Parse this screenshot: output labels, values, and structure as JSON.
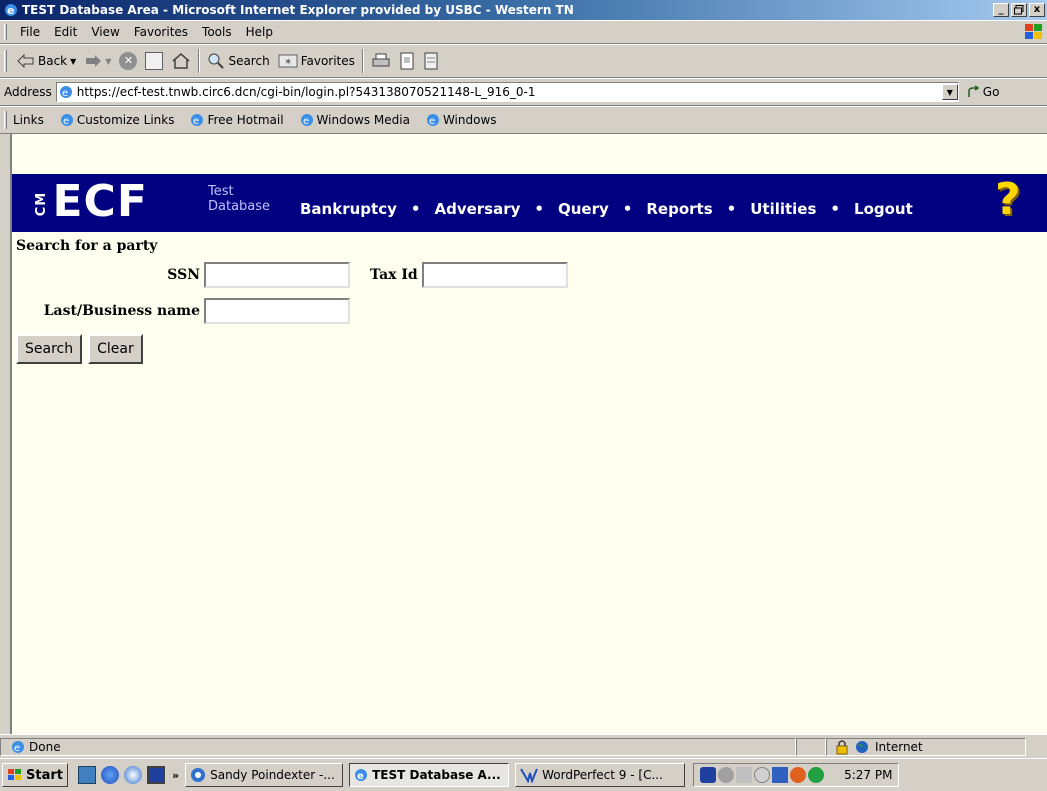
{
  "window": {
    "title": "TEST Database Area - Microsoft Internet Explorer provided by USBC - Western TN",
    "minimize": "_",
    "maximize": "×",
    "close": "x"
  },
  "menu": [
    "File",
    "Edit",
    "View",
    "Favorites",
    "Tools",
    "Help"
  ],
  "toolbar": {
    "back": "Back",
    "search": "Search",
    "favorites": "Favorites"
  },
  "address": {
    "label": "Address",
    "url": "https://ecf-test.tnwb.circ6.dcn/cgi-bin/login.pl?543138070521148-L_916_0-1",
    "go": "Go"
  },
  "links": {
    "label": "Links",
    "items": [
      "Customize Links",
      "Free Hotmail",
      "Windows Media",
      "Windows"
    ]
  },
  "ecf": {
    "logo": "ECF",
    "logo_prefix": "CM",
    "test_label_1": "Test",
    "test_label_2": "Database",
    "nav": [
      "Bankruptcy",
      "Adversary",
      "Query",
      "Reports",
      "Utilities",
      "Logout"
    ],
    "separator": "•",
    "help": "?"
  },
  "form": {
    "heading": "Search for a party",
    "ssn_label": "SSN",
    "ssn_value": "",
    "taxid_label": "Tax Id",
    "taxid_value": "",
    "lastname_label": "Last/Business name",
    "lastname_value": "",
    "search_button": "Search",
    "clear_button": "Clear"
  },
  "status": {
    "text": "Done",
    "zone": "Internet"
  },
  "taskbar": {
    "start": "Start",
    "chevron": "»",
    "tasks": [
      "Sandy Poindexter -...",
      "TEST Database A...",
      "WordPerfect 9 - [C..."
    ],
    "clock": "5:27 PM"
  },
  "colors": {
    "ecf_bar": "#000080",
    "page_bg": "#fffff0",
    "chrome": "#d4d0c8"
  }
}
